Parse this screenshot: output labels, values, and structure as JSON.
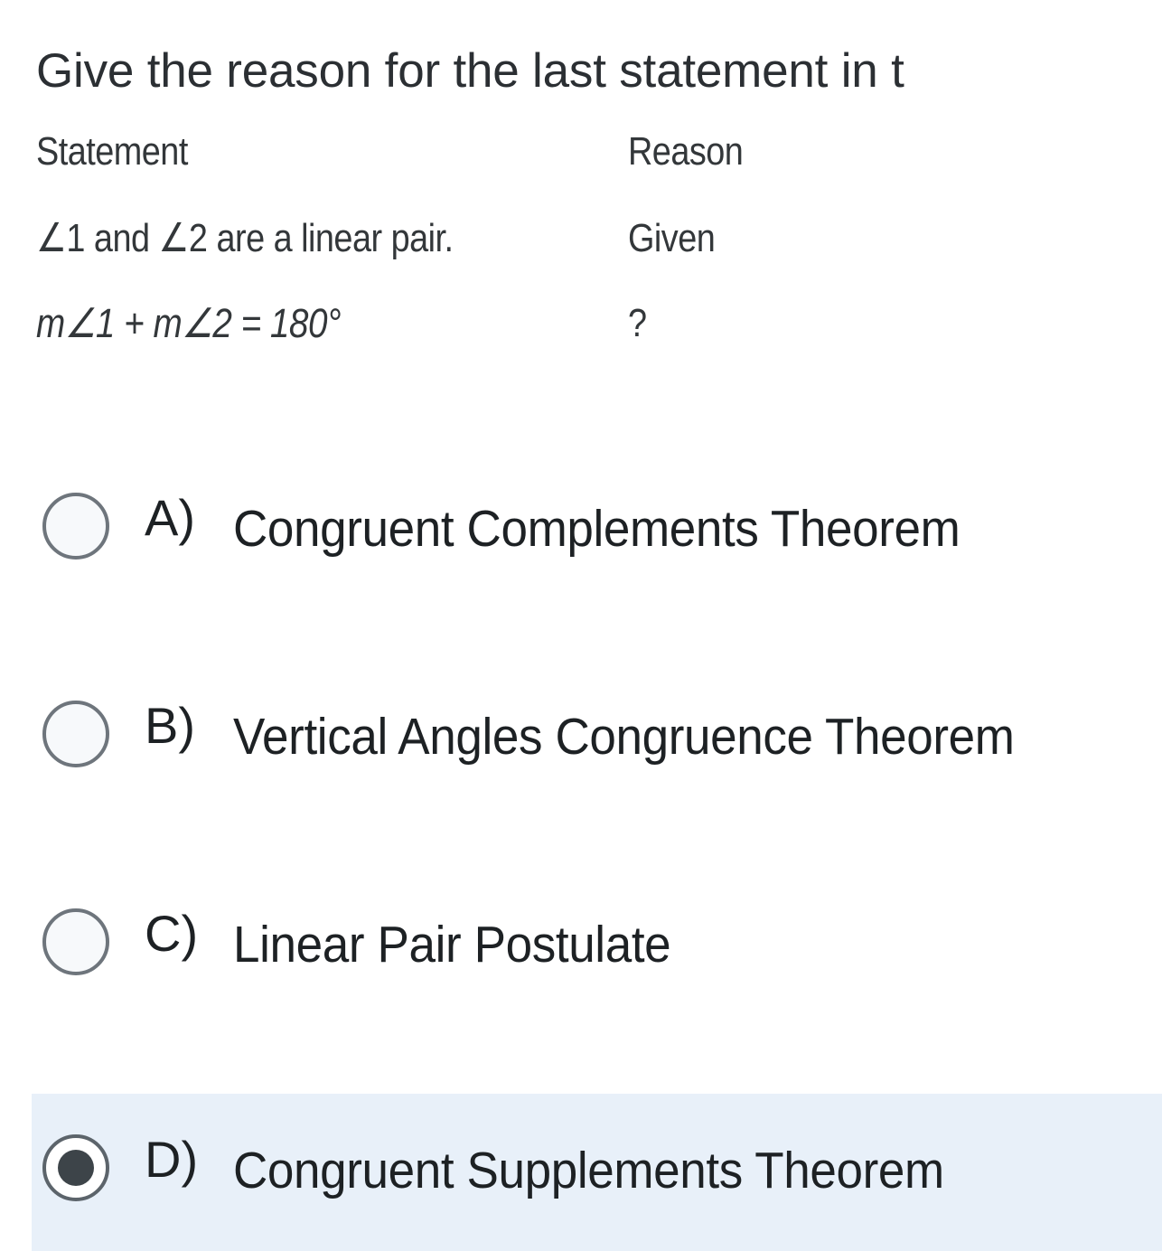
{
  "question": {
    "prompt": "Give the reason for the last statement in t",
    "prompt_note": "text is cropped at the right edge of the screenshot"
  },
  "proof_table": {
    "headers": {
      "statement": "Statement",
      "reason": "Reason"
    },
    "rows": [
      {
        "statement": "∠1 and ∠2 are a linear pair.",
        "reason": "Given"
      },
      {
        "statement": "m∠1 + m∠2 = 180°",
        "reason": "?"
      }
    ]
  },
  "options": [
    {
      "letter": "A)",
      "text": "Congruent Complements Theorem",
      "selected": false
    },
    {
      "letter": "B)",
      "text": "Vertical Angles Congruence Theorem",
      "selected": false
    },
    {
      "letter": "C)",
      "text": "Linear Pair Postulate",
      "selected": false
    },
    {
      "letter": "D)",
      "text": "Congruent Supplements Theorem",
      "selected": true
    }
  ],
  "colors": {
    "page_background": "#ffffff",
    "title_text": "#2b2f33",
    "option_text": "#1d2124",
    "proof_text": "#33373a",
    "radio_border": "#6e757c",
    "radio_dot": "#3d4449",
    "selected_row_highlight": "#e8f0f9"
  }
}
